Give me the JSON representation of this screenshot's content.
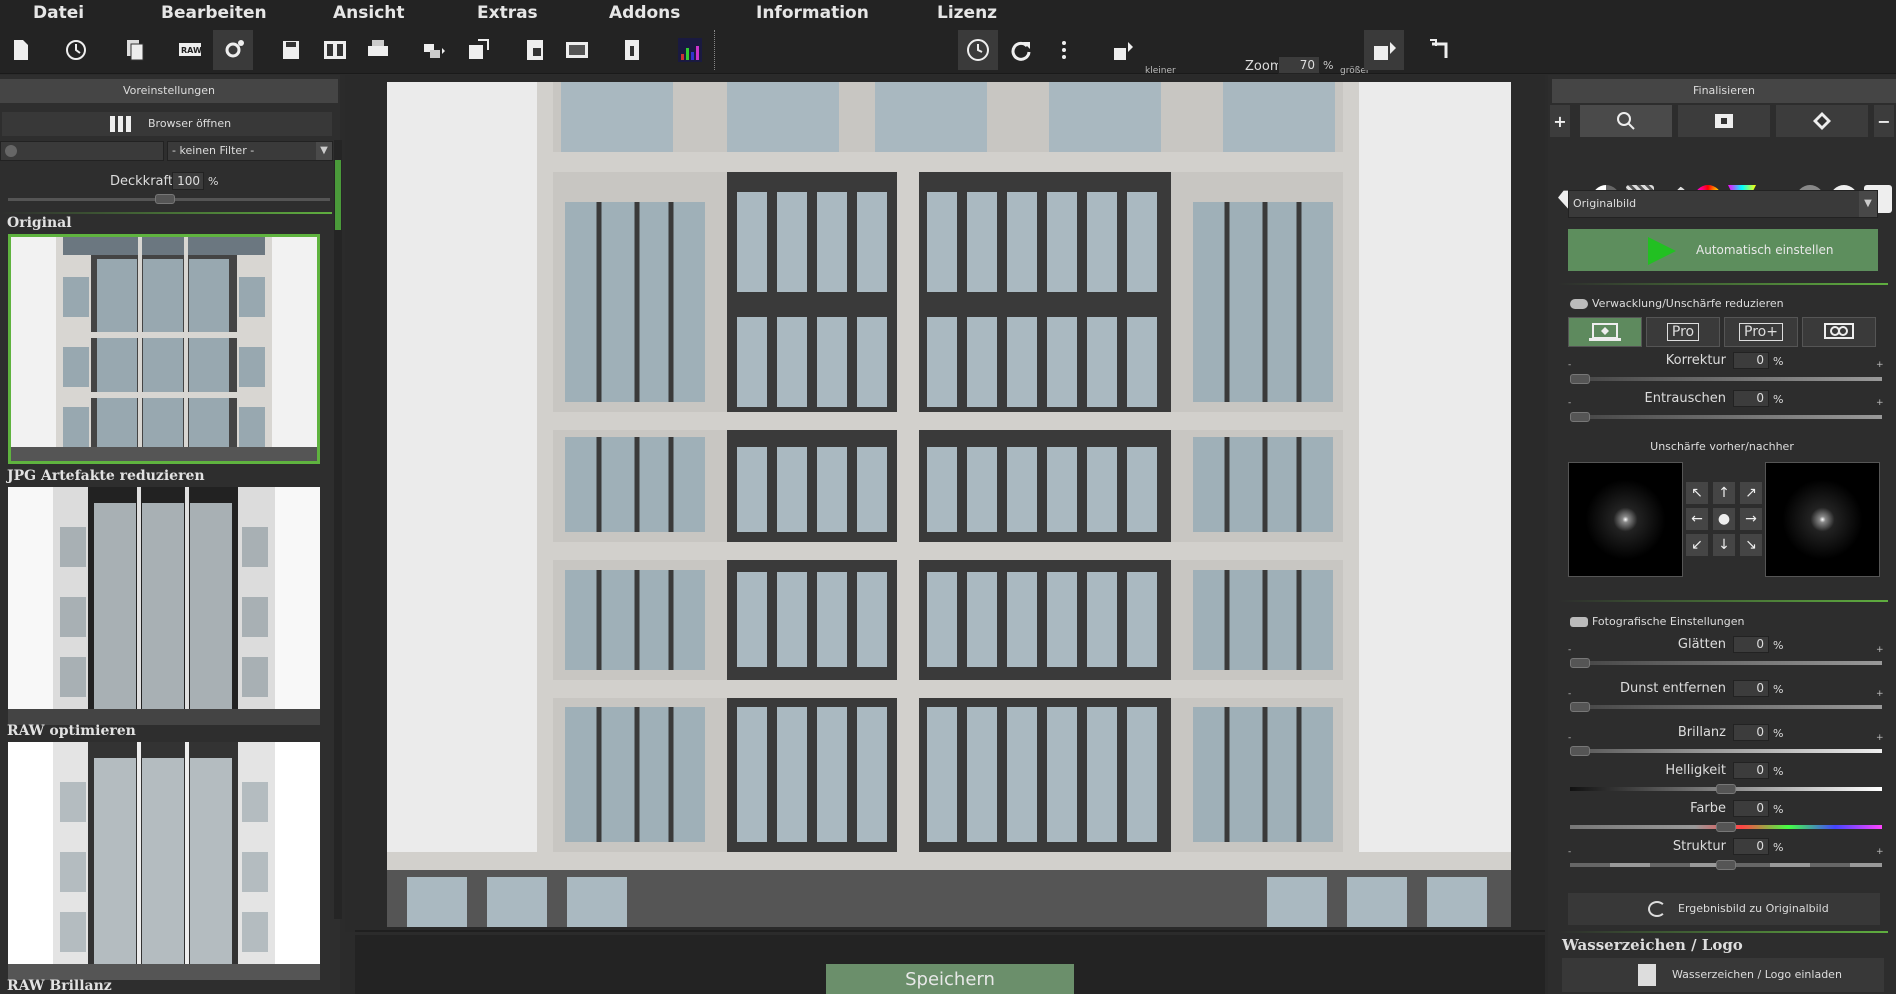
{
  "menu": [
    "Datei",
    "Bearbeiten",
    "Ansicht",
    "Extras",
    "Addons",
    "Information",
    "Lizenz"
  ],
  "toolbar": {
    "zoom_small_label": "kleiner",
    "zoom_big_label": "größer",
    "zoom_label": "Zoom",
    "zoom_value": "70",
    "zoom_unit": "%"
  },
  "left": {
    "header": "Voreinstellungen",
    "browser_button": "Browser öffnen",
    "filter_value": "- keinen Filter -",
    "deck_label": "Deckkraft",
    "deck_value": "100",
    "deck_unit": "%",
    "presets": [
      {
        "label": "Original"
      },
      {
        "label": "JPG Artefakte reduzieren"
      },
      {
        "label": "RAW optimieren"
      },
      {
        "label": "RAW Brillanz"
      }
    ]
  },
  "center": {
    "save_label": "Speichern"
  },
  "right": {
    "header": "Finalisieren",
    "orig_select": "Originalbild",
    "auto_button": "Automatisch einstellen",
    "blur_section": "Verwacklung/Unschärfe reduzieren",
    "mode_pro": "Pro",
    "mode_proplus": "Pro+",
    "sliders_blur": [
      {
        "label": "Korrektur",
        "value": "0"
      },
      {
        "label": "Entrauschen",
        "value": "0"
      }
    ],
    "blur_compare": "Unschärfe vorher/nachher",
    "photo_section": "Fotografische Einstellungen",
    "sliders_photo": [
      {
        "label": "Glätten",
        "value": "0"
      },
      {
        "label": "Dunst entfernen",
        "value": "0"
      },
      {
        "label": "Brillanz",
        "value": "0"
      },
      {
        "label": "Helligkeit",
        "value": "0"
      },
      {
        "label": "Farbe",
        "value": "0"
      },
      {
        "label": "Struktur",
        "value": "0"
      }
    ],
    "unit": "%",
    "result_button": "Ergebnisbild zu Originalbild",
    "watermark_title": "Wasserzeichen / Logo",
    "watermark_button": "Wasserzeichen / Logo einladen"
  }
}
